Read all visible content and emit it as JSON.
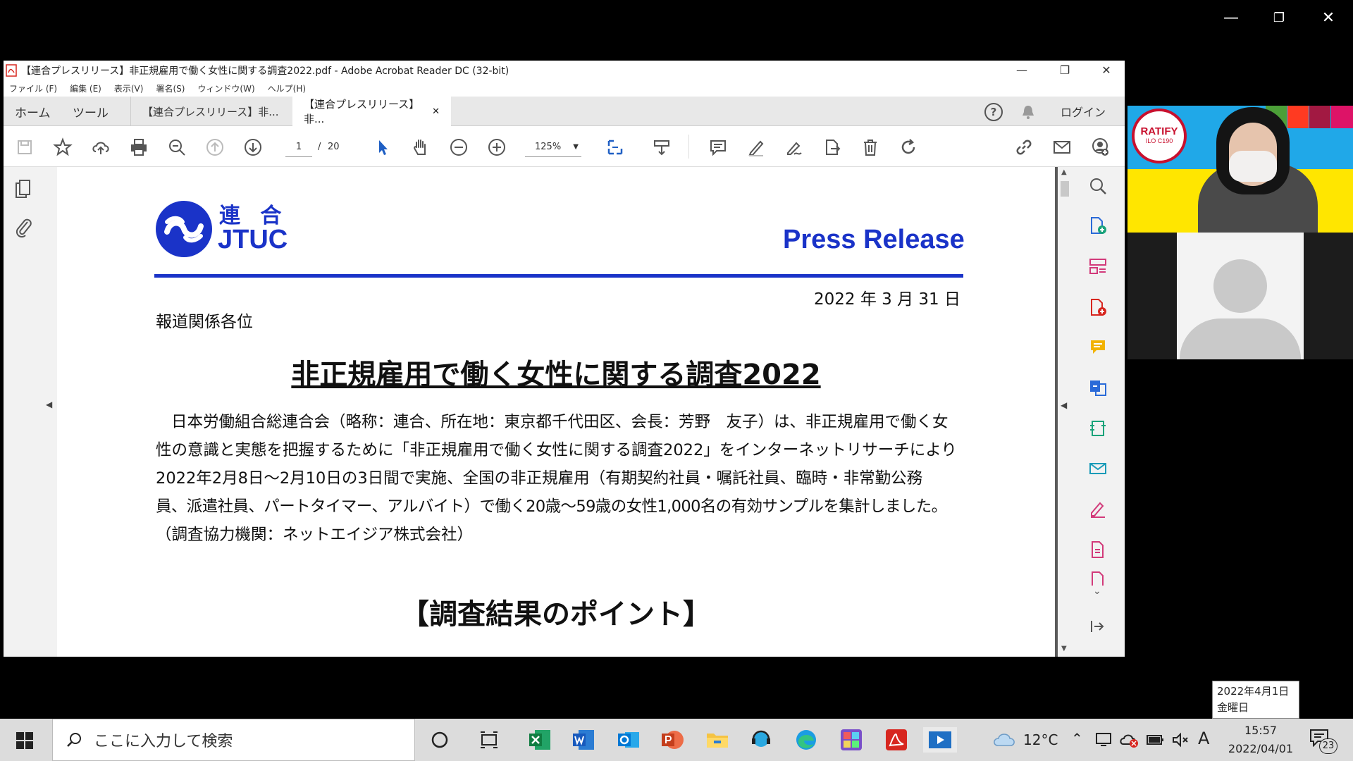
{
  "outer_window": {
    "minimize": "—",
    "restore": "❐",
    "close": "✕"
  },
  "acrobat": {
    "title": "【連合プレスリリース】非正規雇用で働く女性に関する調査2022.pdf - Adobe Acrobat Reader DC (32-bit)",
    "menu": [
      "ファイル (F)",
      "編集 (E)",
      "表示(V)",
      "署名(S)",
      "ウィンドウ(W)",
      "ヘルプ(H)"
    ],
    "tabs": {
      "home": "ホーム",
      "tools": "ツール",
      "doc_tab_1": "【連合プレスリリース】非...",
      "doc_tab_2": "【連合プレスリリース】非...",
      "close_tab": "✕"
    },
    "header_right": {
      "help": "?",
      "login": "ログイン"
    },
    "toolbar": {
      "page_current": "1",
      "page_sep": "/",
      "page_total": "20",
      "zoom": "125%"
    }
  },
  "document": {
    "logo_kanji": "連 合",
    "logo_en": "JTUC",
    "press_release": "Press Release",
    "date": "2022 年 3 月 31 日",
    "addressee": "報道関係各位",
    "title": "非正規雇用で働く女性に関する調査2022",
    "body_lines": [
      "日本労働組合総連合会（略称：連合、所在地：東京都千代田区、会長：芳野　友子）は、非正規雇用で働く女",
      "性の意識と実態を把握するために「非正規雇用で働く女性に関する調査2022」をインターネットリサーチにより",
      "2022年2月8日～2月10日の3日間で実施、全国の非正規雇用（有期契約社員・嘱託社員、臨時・非常勤公務",
      "員、派遣社員、パートタイマー、アルバイト）で働く20歳～59歳の女性1,000名の有効サンプルを集計しました。",
      "（調査協力機関：ネットエイジア株式会社）"
    ],
    "section_heading": "【調査結果のポイント】"
  },
  "video": {
    "badge_text": "RATIFY",
    "badge_sub": "ILO C190"
  },
  "taskbar": {
    "search_placeholder": "ここに入力して検索",
    "weather": "12°C",
    "ime": "A",
    "time": "15:57",
    "date": "2022/04/01",
    "notification_count": "23"
  },
  "tooltip": {
    "line1": "2022年4月1日",
    "line2": "金曜日"
  },
  "colors": {
    "brand_blue": "#1a33c8",
    "acrobat_red": "#d7261f",
    "rail_pink": "#d23a7a",
    "rail_blue": "#2a6ad8"
  }
}
